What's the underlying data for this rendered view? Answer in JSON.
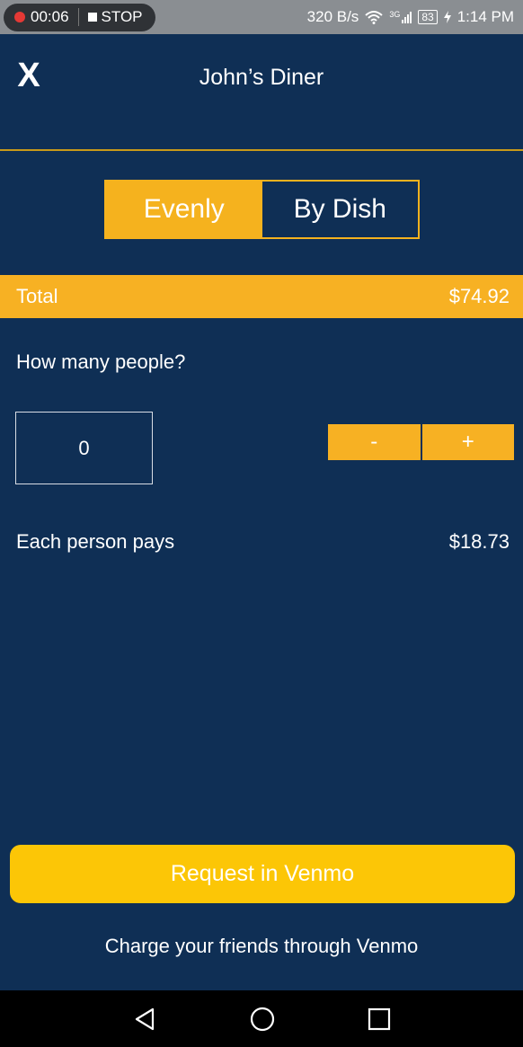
{
  "status_bar": {
    "rec_time": "00:06",
    "stop_label": "STOP",
    "net_speed": "320 B/s",
    "network_type": "3G",
    "battery": "83",
    "time": "1:14 PM",
    "icons": [
      "record-dot-icon",
      "stop-square-icon",
      "wifi-icon",
      "signal-icon",
      "battery-icon",
      "charging-icon"
    ]
  },
  "header": {
    "close_label": "X",
    "title": "John’s Diner"
  },
  "split_mode": {
    "options": [
      {
        "label": "Evenly",
        "active": true
      },
      {
        "label": "By Dish",
        "active": false
      }
    ]
  },
  "total": {
    "label": "Total",
    "amount": "$74.92"
  },
  "people": {
    "question": "How many people?",
    "count": "0",
    "decrement_label": "-",
    "increment_label": "+"
  },
  "each_person": {
    "label": "Each person pays",
    "amount": "$18.73"
  },
  "venmo": {
    "button_label": "Request in Venmo",
    "caption": "Charge your friends through Venmo"
  },
  "nav": {
    "icons": [
      "back-triangle-icon",
      "home-circle-icon",
      "recents-square-icon"
    ]
  },
  "colors": {
    "background": "#0f2f55",
    "accent": "#f7b123",
    "venmo_button": "#fcc606",
    "header_rule": "#c89a1a",
    "status_bar": "#8a8e92"
  }
}
